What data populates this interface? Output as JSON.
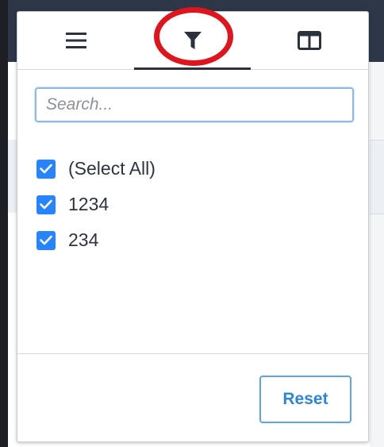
{
  "menu": {
    "tabs": [
      {
        "id": "general",
        "icon": "hamburger-menu-icon"
      },
      {
        "id": "filter",
        "icon": "filter-funnel-icon",
        "active": true
      },
      {
        "id": "columns",
        "icon": "columns-icon"
      }
    ],
    "search": {
      "value": "",
      "placeholder": "Search..."
    },
    "items": [
      {
        "label": "(Select All)",
        "checked": true
      },
      {
        "label": "1234",
        "checked": true
      },
      {
        "label": "234",
        "checked": true
      }
    ],
    "reset_label": "Reset"
  },
  "colors": {
    "accent": "#2684ff",
    "highlight_ring": "#e0141d",
    "reset_text": "#2b86d9"
  }
}
